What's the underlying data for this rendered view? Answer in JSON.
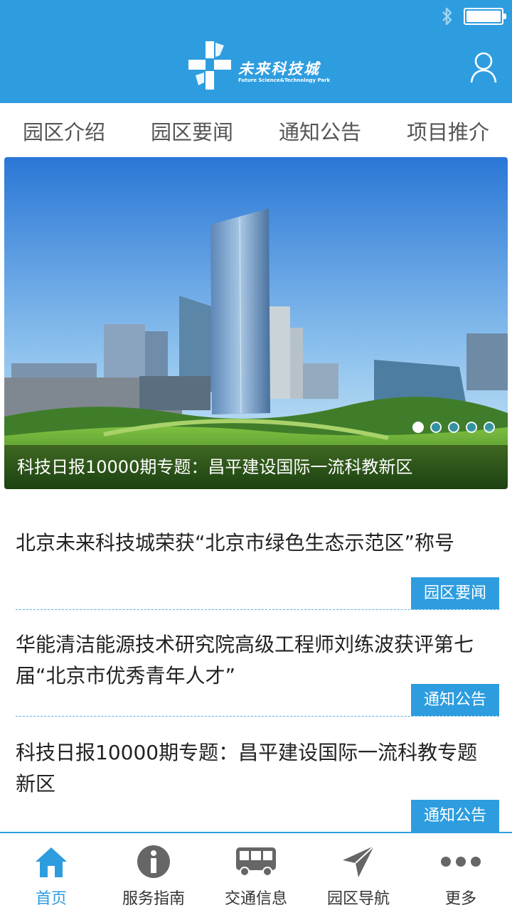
{
  "header": {
    "logo_cn": "未来科技城",
    "logo_en": "Future Science&Technology Park",
    "brand_color": "#2e9ddf"
  },
  "tabs": [
    {
      "label": "园区介绍"
    },
    {
      "label": "园区要闻"
    },
    {
      "label": "通知公告"
    },
    {
      "label": "项目推介"
    }
  ],
  "banner": {
    "caption": "科技日报10000期专题：昌平建设国际一流科教新区",
    "slide_count": 5,
    "active_slide": 1
  },
  "news": [
    {
      "title": "北京未来科技城荣获“北京市绿色生态示范区”称号",
      "tag": "园区要闻"
    },
    {
      "title": "华能清洁能源技术研究院高级工程师刘练波获评第七届“北京市优秀青年人才”",
      "tag": "通知公告"
    },
    {
      "title": "科技日报10000期专题：昌平建设国际一流科教专题新区",
      "tag": "通知公告"
    }
  ],
  "bottom_nav": [
    {
      "label": "首页",
      "icon": "home-icon",
      "active": true
    },
    {
      "label": "服务指南",
      "icon": "info-icon",
      "active": false
    },
    {
      "label": "交通信息",
      "icon": "bus-icon",
      "active": false
    },
    {
      "label": "园区导航",
      "icon": "navigation-icon",
      "active": false
    },
    {
      "label": "更多",
      "icon": "more-icon",
      "active": false
    }
  ]
}
